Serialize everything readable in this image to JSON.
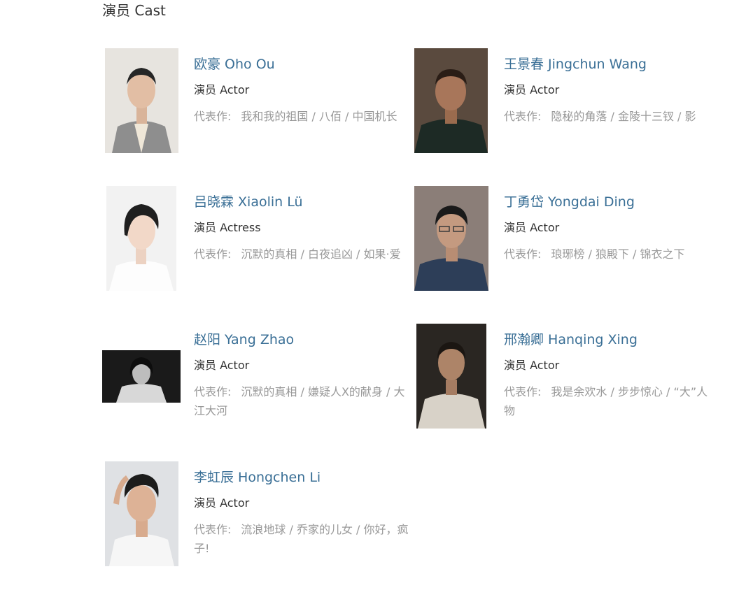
{
  "section": {
    "title": "演员 Cast"
  },
  "cast": [
    {
      "name": "欧豪 Oho Ou",
      "role": "演员 Actor",
      "works_label": "代表作:",
      "works": "我和我的祖国 / 八佰 / 中国机长"
    },
    {
      "name": "王景春 Jingchun Wang",
      "role": "演员 Actor",
      "works_label": "代表作:",
      "works": "隐秘的角落 / 金陵十三钗 / 影"
    },
    {
      "name": "吕晓霖 Xiaolin Lü",
      "role": "演员 Actress",
      "works_label": "代表作:",
      "works": "沉默的真相 / 白夜追凶 / 如果·爱"
    },
    {
      "name": "丁勇岱 Yongdai Ding",
      "role": "演员 Actor",
      "works_label": "代表作:",
      "works": "琅琊榜 / 狼殿下 / 锦衣之下"
    },
    {
      "name": "赵阳 Yang Zhao",
      "role": "演员 Actor",
      "works_label": "代表作:",
      "works": "沉默的真相 / 嫌疑人X的献身 / 大江大河"
    },
    {
      "name": "邢瀚卿 Hanqing Xing",
      "role": "演员 Actor",
      "works_label": "代表作:",
      "works": "我是余欢水 / 步步惊心 / “大”人物"
    },
    {
      "name": "李虹辰 Hongchen Li",
      "role": "演员 Actor",
      "works_label": "代表作:",
      "works": "流浪地球 / 乔家的儿女 / 你好，疯子!"
    }
  ]
}
